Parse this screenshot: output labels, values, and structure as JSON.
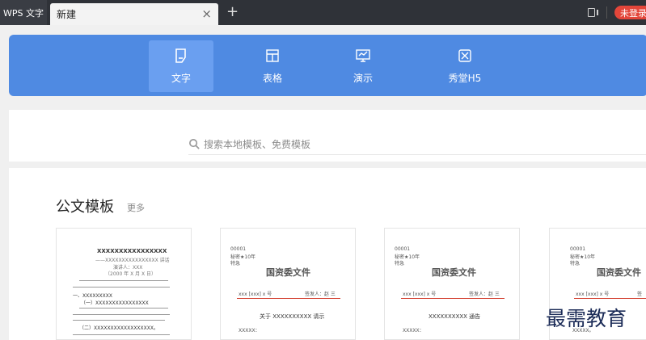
{
  "title_bar": {
    "app_label": "WPS 文字",
    "tab_label": "新建",
    "close_symbol": "×",
    "add_symbol": "+",
    "login_label": "未登录"
  },
  "categories": [
    {
      "label": "文字",
      "icon": "document-icon",
      "active": true
    },
    {
      "label": "表格",
      "icon": "table-icon",
      "active": false
    },
    {
      "label": "演示",
      "icon": "presentation-icon",
      "active": false
    },
    {
      "label": "秀堂H5",
      "icon": "h5-icon",
      "active": false
    }
  ],
  "search": {
    "placeholder": "搜索本地模板、免费模板"
  },
  "section": {
    "title": "公文模板",
    "more": "更多"
  },
  "cards": [
    {
      "kind": "plain",
      "title": "XXXXXXXXXXXXXXXX",
      "subtitle": "——XXXXXXXXXXXXXXXX 讲话",
      "author": "演讲人：XXX",
      "date": "（2000 年 X 月 X 日）",
      "section1": "一、XXXXXXXXX",
      "item1": "（一）XXXXXXXXXXXXXXXX",
      "item2": "（二）XXXXXXXXXXXXXXXXXX。"
    },
    {
      "kind": "official",
      "code": "00001",
      "secret": "秘密★10年",
      "urgency": "特急",
      "header": "国资委文件",
      "doc_no": "xxx [xxx] x 号",
      "signer": "签发人：赵 三",
      "doc_title": "关于 XXXXXXXXXX 请示",
      "recipient": "XXXXX："
    },
    {
      "kind": "official",
      "code": "00001",
      "secret": "秘密★10年",
      "urgency": "特急",
      "header": "国资委文件",
      "doc_no": "xxx [xxx] x 号",
      "signer": "签发人：赵 三",
      "doc_title": "XXXXXXXXXX 通告",
      "recipient": "XXXXX："
    },
    {
      "kind": "official",
      "code": "00001",
      "secret": "秘密★10年",
      "urgency": "特急",
      "header": "国资委文件",
      "doc_no": "xxx [xxx] x 号",
      "signer": "签",
      "doc_title": "",
      "recipient": "XXXXX。"
    }
  ],
  "watermark": "最需教育",
  "colors": {
    "banner": "#4f8ae2",
    "active_category": "#6a9ff0",
    "title_bar": "#2f3238",
    "login": "#e3463a",
    "template_red": "#d23a2a"
  }
}
